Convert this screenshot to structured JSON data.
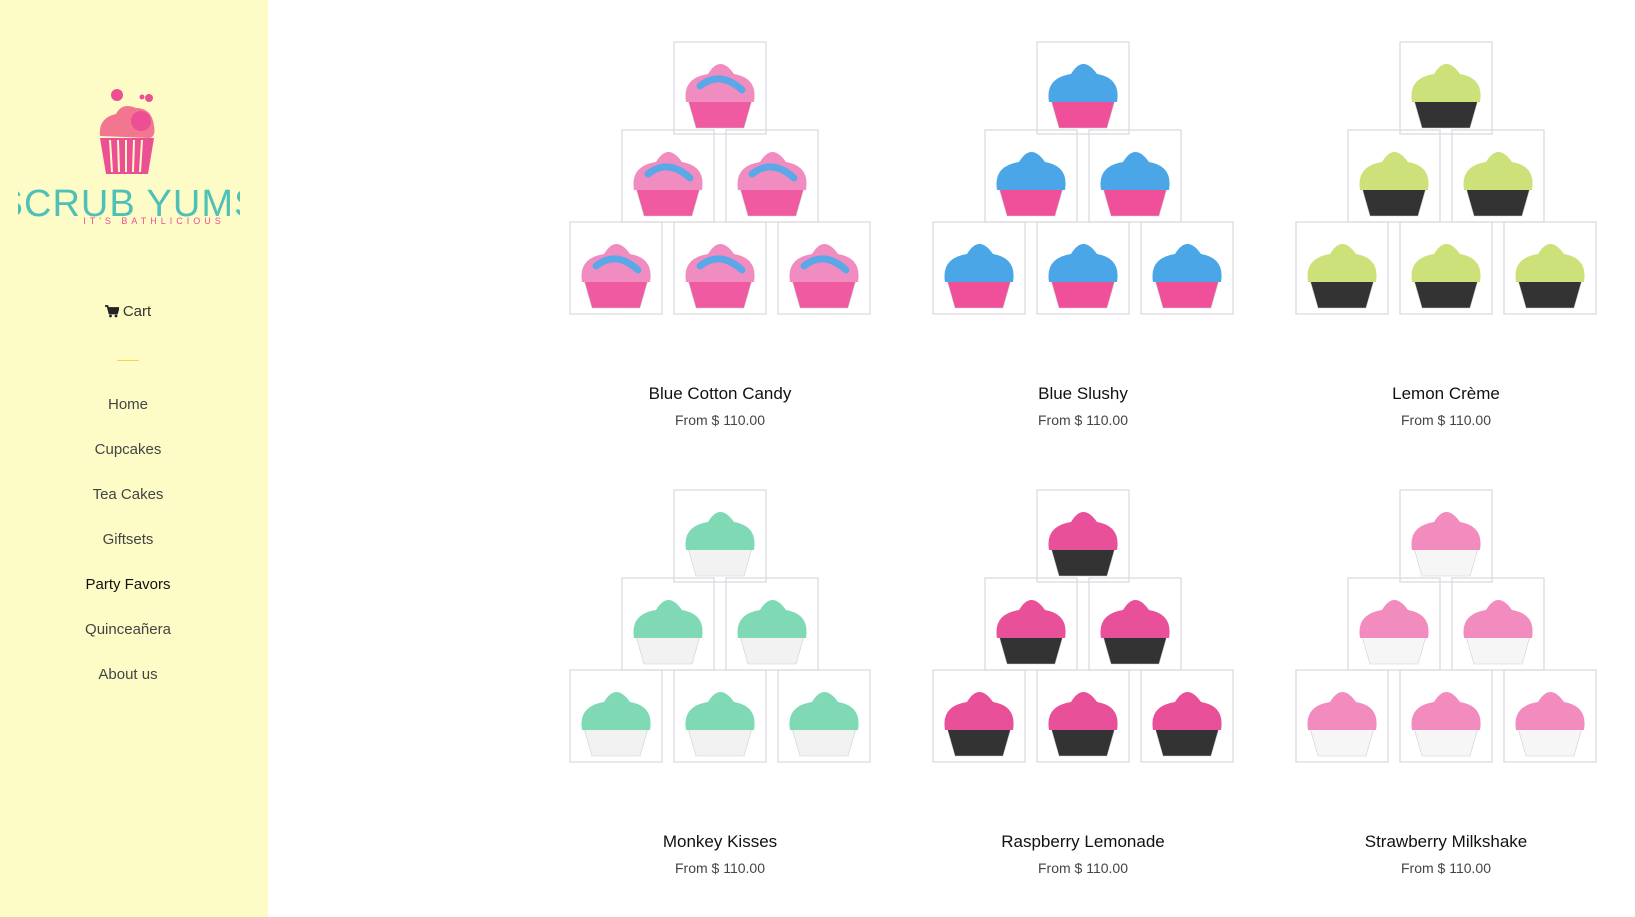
{
  "brand": {
    "name": "SCRUB YUMS",
    "tagline": "IT'S BATHLICIOUS"
  },
  "colors": {
    "sidebar_bg": "#fdfcc6",
    "brand_teal": "#4fc0b8",
    "brand_pink": "#ec4f93"
  },
  "cart": {
    "label": "Cart",
    "icon": "shopping-cart-icon"
  },
  "nav": {
    "items": [
      {
        "label": "Home"
      },
      {
        "label": "Cupcakes"
      },
      {
        "label": "Tea Cakes"
      },
      {
        "label": "Giftsets"
      },
      {
        "label": "Party Favors"
      },
      {
        "label": "Quinceañera"
      },
      {
        "label": "About us"
      }
    ],
    "active_index": 4
  },
  "products": [
    {
      "title": "Blue Cotton Candy",
      "price": "From $ 110.00",
      "frost": "#f18cc0",
      "frost2": "#5aa8e8",
      "liner": "#f05aa0"
    },
    {
      "title": "Blue Slushy",
      "price": "From $ 110.00",
      "frost": "#4aa6e6",
      "frost2": "#4aa6e6",
      "liner": "#f0509a"
    },
    {
      "title": "Lemon Crème",
      "price": "From $ 110.00",
      "frost": "#cde17a",
      "frost2": "#cde17a",
      "liner": "#333333"
    },
    {
      "title": "Monkey Kisses",
      "price": "From $ 110.00",
      "frost": "#7ed9b4",
      "frost2": "#7ed9b4",
      "liner": "#f2f2f2"
    },
    {
      "title": "Raspberry Lemonade",
      "price": "From $ 110.00",
      "frost": "#e8509a",
      "frost2": "#e8509a",
      "liner": "#333333"
    },
    {
      "title": "Strawberry Milkshake",
      "price": "From $ 110.00",
      "frost": "#f28cbe",
      "frost2": "#f28cbe",
      "liner": "#f6f6f6"
    }
  ]
}
